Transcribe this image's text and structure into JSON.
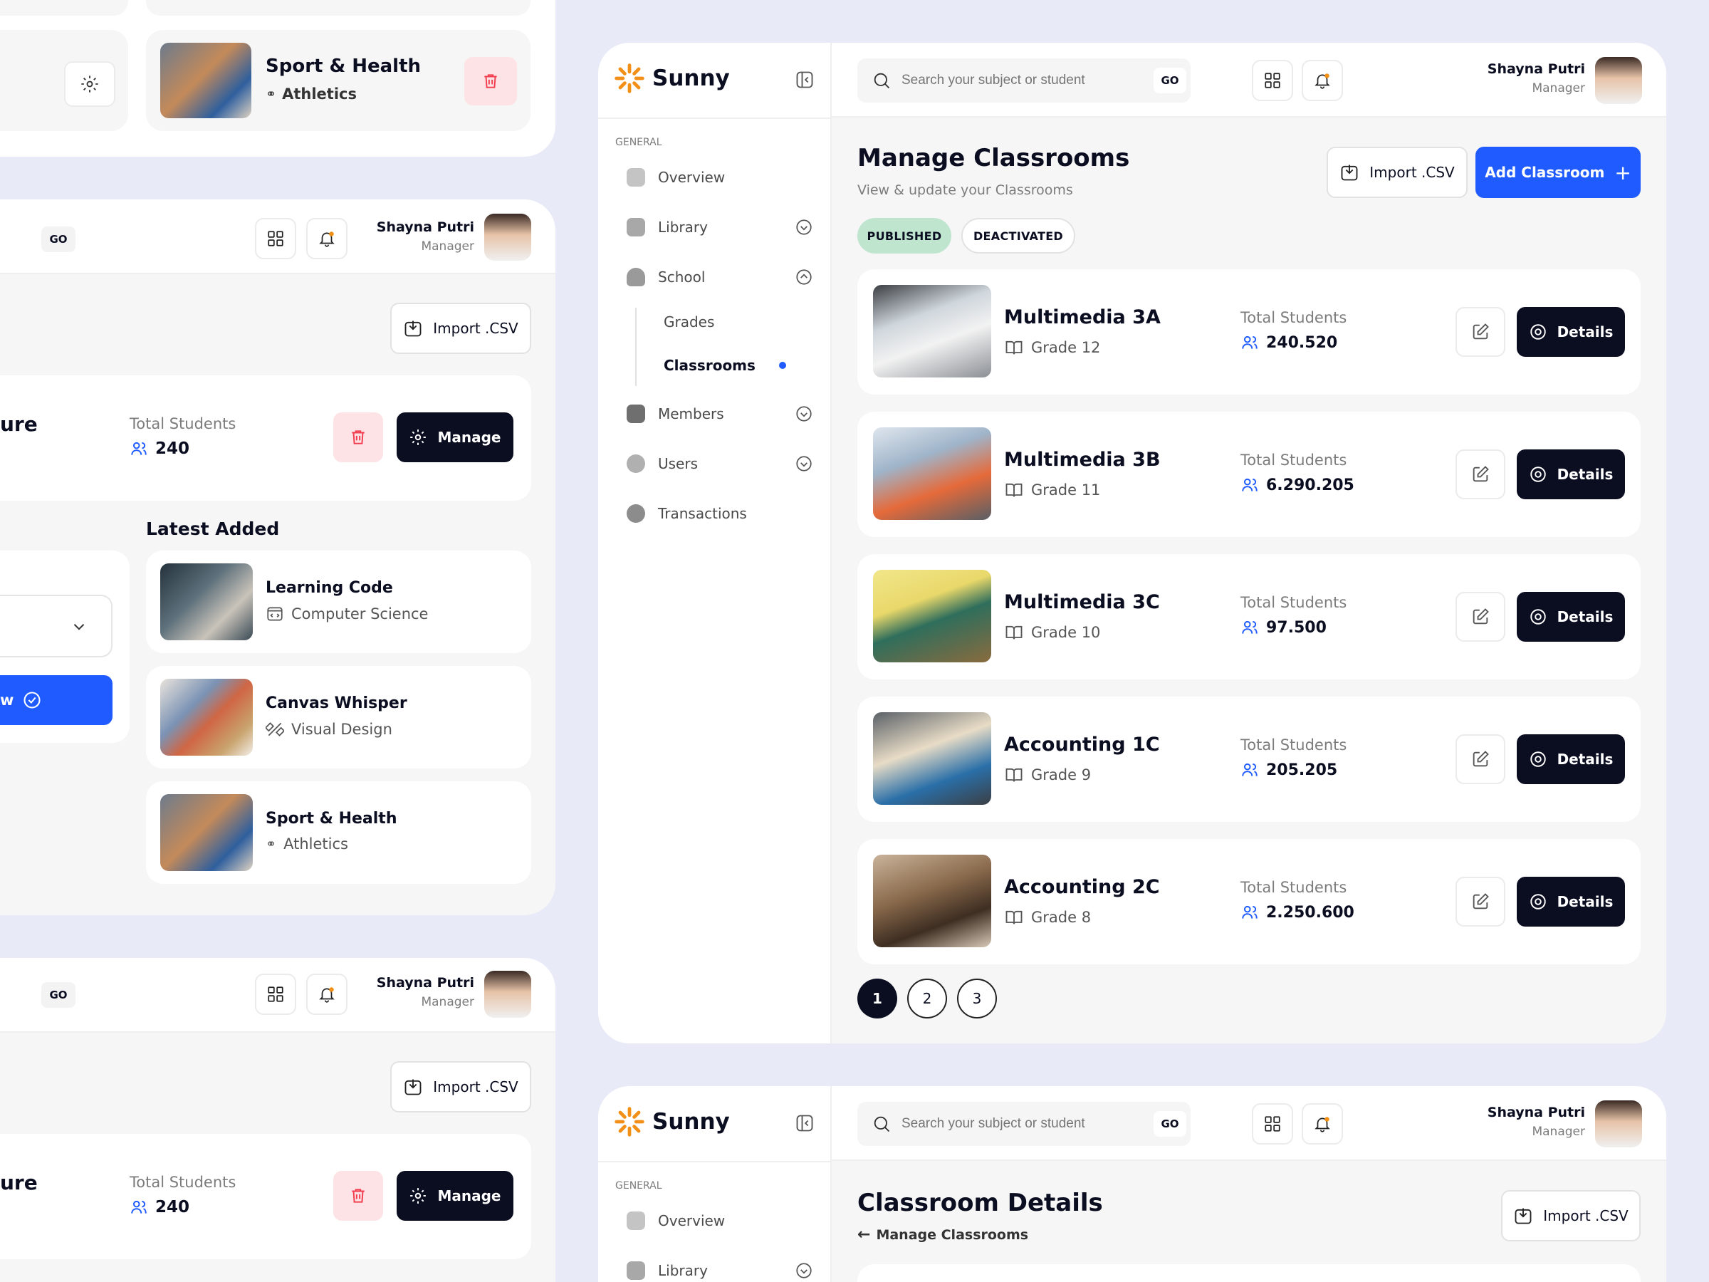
{
  "app": {
    "name": "Sunny"
  },
  "user": {
    "name": "Shayna Putri",
    "role": "Manager"
  },
  "search": {
    "placeholder": "Search your subject or student",
    "go": "GO"
  },
  "sidebar": {
    "section": "GENERAL",
    "items": [
      {
        "label": "Overview"
      },
      {
        "label": "Library"
      },
      {
        "label": "School"
      },
      {
        "label": "Members"
      },
      {
        "label": "Users"
      },
      {
        "label": "Transactions"
      }
    ],
    "school_sub": [
      {
        "label": "Grades"
      },
      {
        "label": "Classrooms"
      }
    ]
  },
  "main": {
    "title": "Manage Classrooms",
    "subtitle": "View & update your Classrooms",
    "import_label": "Import .CSV",
    "add_label": "Add Classroom",
    "tabs": [
      {
        "label": "PUBLISHED"
      },
      {
        "label": "DEACTIVATED"
      }
    ],
    "total_label": "Total Students",
    "details_label": "Details",
    "classrooms": [
      {
        "name": "Multimedia 3A",
        "grade": "Grade 12",
        "students": "240.520"
      },
      {
        "name": "Multimedia 3B",
        "grade": "Grade 11",
        "students": "6.290.205"
      },
      {
        "name": "Multimedia 3C",
        "grade": "Grade 10",
        "students": "97.500"
      },
      {
        "name": "Accounting 1C",
        "grade": "Grade 9",
        "students": "205.205"
      },
      {
        "name": "Accounting 2C",
        "grade": "Grade 8",
        "students": "2.250.600"
      }
    ],
    "pages": [
      "1",
      "2",
      "3"
    ]
  },
  "details": {
    "title": "Classroom Details",
    "back": "Manage Classrooms",
    "import_label": "Import .CSV"
  },
  "left": {
    "top_card": {
      "title": "Sport & Health",
      "subtitle": "Athletics"
    },
    "import_label": "Import .CSV",
    "partial_title": "ure",
    "total_label": "Total Students",
    "total_value": "240",
    "manage_label": "Manage",
    "latest_title": "Latest Added",
    "view_partial": "w",
    "latest": [
      {
        "title": "Learning Code",
        "subtitle": "Computer Science"
      },
      {
        "title": "Canvas Whisper",
        "subtitle": "Visual Design"
      },
      {
        "title": "Sport & Health",
        "subtitle": "Athletics"
      }
    ]
  },
  "colors": {
    "primary": "#1F5BFF",
    "dark": "#0B0D21",
    "green_tag": "#BFE5CF",
    "danger": "#F23D4F",
    "accent": "#F28F16"
  }
}
